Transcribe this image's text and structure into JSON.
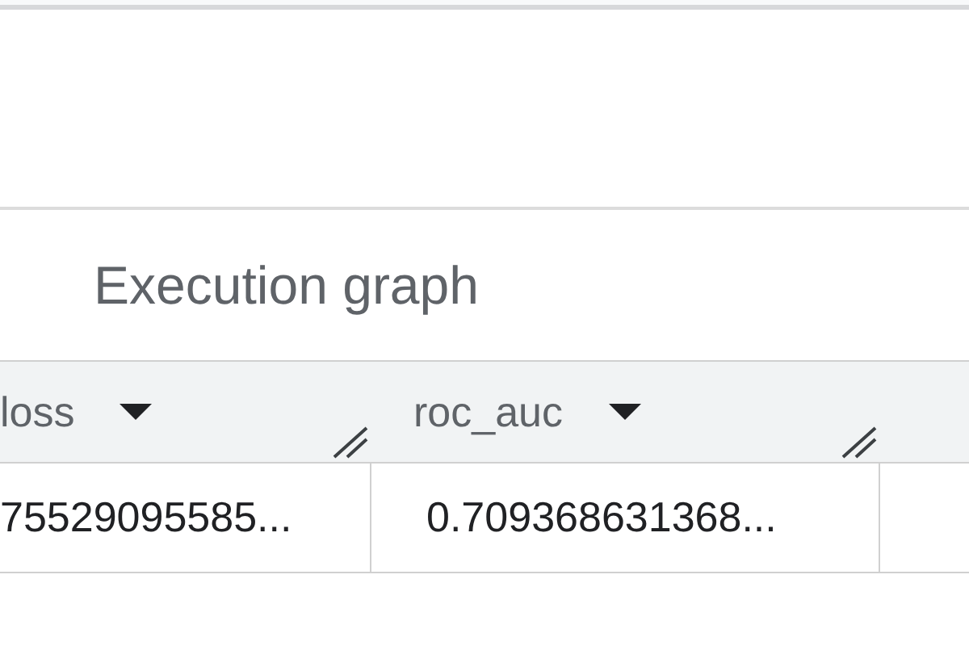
{
  "section_title": "Execution graph",
  "table": {
    "columns": [
      {
        "label": "loss"
      },
      {
        "label": "roc_auc"
      },
      {}
    ],
    "rows": [
      {
        "cells": [
          "75529095585...",
          "0.709368631368..."
        ]
      }
    ]
  }
}
